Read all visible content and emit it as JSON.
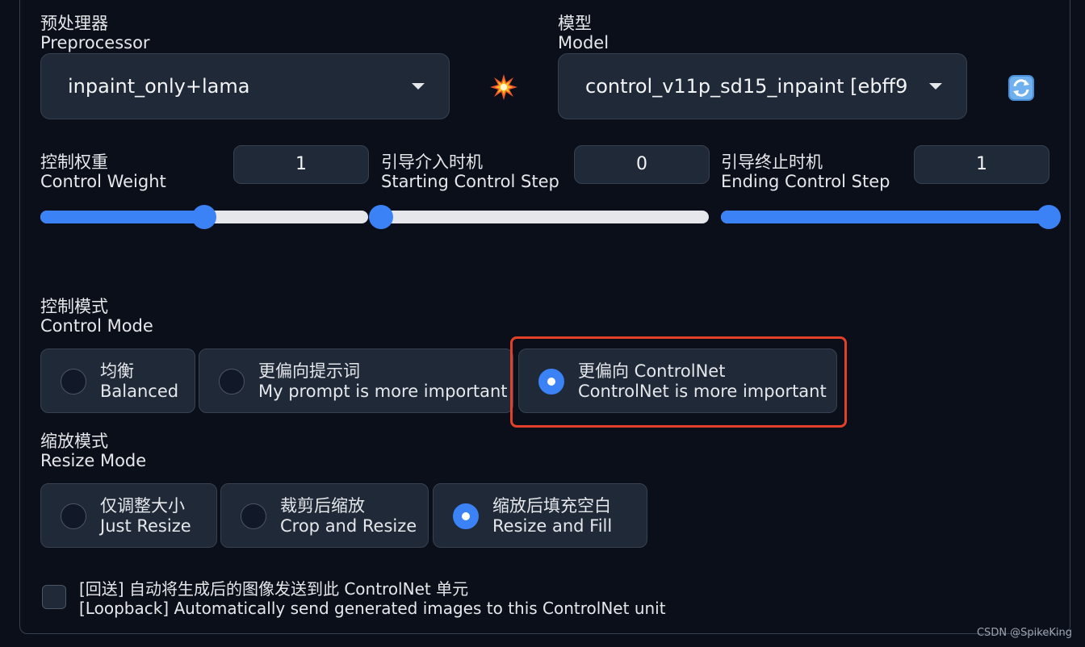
{
  "preprocessor": {
    "label_zh": "预处理器",
    "label_en": "Preprocessor",
    "value": "inpaint_only+lama"
  },
  "model": {
    "label_zh": "模型",
    "label_en": "Model",
    "value": "control_v11p_sd15_inpaint [ebff9"
  },
  "icons": {
    "run_preprocessor": "explosion-icon",
    "refresh_models": "refresh-icon"
  },
  "sliders": [
    {
      "label_zh": "控制权重",
      "label_en": "Control Weight",
      "value": "1",
      "fraction": 0.5
    },
    {
      "label_zh": "引导介入时机",
      "label_en": "Starting Control Step",
      "value": "0",
      "fraction": 0
    },
    {
      "label_zh": "引导终止时机",
      "label_en": "Ending Control Step",
      "value": "1",
      "fraction": 1
    }
  ],
  "control_mode": {
    "label_zh": "控制模式",
    "label_en": "Control Mode",
    "options": [
      {
        "zh": "均衡",
        "en": "Balanced",
        "selected": false
      },
      {
        "zh": "更偏向提示词",
        "en": "My prompt is more important",
        "selected": false
      },
      {
        "zh": "更偏向 ControlNet",
        "en": "ControlNet is more important",
        "selected": true
      }
    ]
  },
  "resize_mode": {
    "label_zh": "缩放模式",
    "label_en": "Resize Mode",
    "options": [
      {
        "zh": "仅调整大小",
        "en": "Just Resize",
        "selected": false
      },
      {
        "zh": "裁剪后缩放",
        "en": "Crop and Resize",
        "selected": false
      },
      {
        "zh": "缩放后填充空白",
        "en": "Resize and Fill",
        "selected": true
      }
    ]
  },
  "loopback": {
    "label_zh": "[回送] 自动将生成后的图像发送到此 ControlNet 单元",
    "label_en": "[Loopback] Automatically send generated images to this ControlNet unit",
    "checked": false
  },
  "colors": {
    "accent": "#3b82f6",
    "highlight": "#e3402a",
    "background": "#0b0f19"
  },
  "watermark": "CSDN @SpikeKing"
}
